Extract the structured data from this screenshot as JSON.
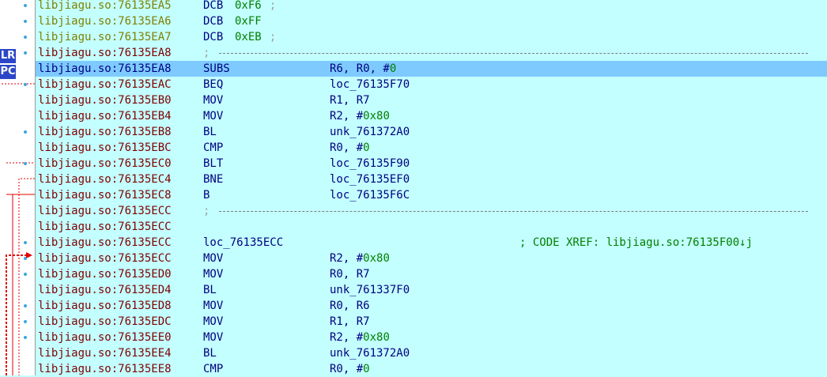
{
  "markers": {
    "lr": "LR",
    "pc": "PC"
  },
  "lines": [
    {
      "addr": "libjiagu.so:76135EA5",
      "type": "data",
      "mnemonic": "DCB",
      "operand": "0xF6",
      "trailing": ";"
    },
    {
      "addr": "libjiagu.so:76135EA6",
      "type": "data",
      "mnemonic": "DCB",
      "operand": "0xFF"
    },
    {
      "addr": "libjiagu.so:76135EA7",
      "type": "data",
      "mnemonic": "DCB",
      "operand": "0xEB",
      "trailing": ";"
    },
    {
      "addr": "libjiagu.so:76135EA8",
      "type": "separator",
      "trailing": ";"
    },
    {
      "addr": "libjiagu.so:76135EA8",
      "type": "code",
      "mnemonic": "SUBS",
      "op1": "R6, R0, #",
      "num": "0",
      "highlighted": true
    },
    {
      "addr": "libjiagu.so:76135EAC",
      "type": "code",
      "mnemonic": "BEQ",
      "op1": "loc_76135F70"
    },
    {
      "addr": "libjiagu.so:76135EB0",
      "type": "code",
      "mnemonic": "MOV",
      "op1": "R1, R7"
    },
    {
      "addr": "libjiagu.so:76135EB4",
      "type": "code",
      "mnemonic": "MOV",
      "op1": "R2, #",
      "num": "0x80"
    },
    {
      "addr": "libjiagu.so:76135EB8",
      "type": "code",
      "mnemonic": "BL",
      "op1": "unk_761372A0"
    },
    {
      "addr": "libjiagu.so:76135EBC",
      "type": "code",
      "mnemonic": "CMP",
      "op1": "R0, #",
      "num": "0"
    },
    {
      "addr": "libjiagu.so:76135EC0",
      "type": "code",
      "mnemonic": "BLT",
      "op1": "loc_76135F90"
    },
    {
      "addr": "libjiagu.so:76135EC4",
      "type": "code",
      "mnemonic": "BNE",
      "op1": "loc_76135EF0"
    },
    {
      "addr": "libjiagu.so:76135EC8",
      "type": "code",
      "mnemonic": "B",
      "op1": "loc_76135F6C"
    },
    {
      "addr": "libjiagu.so:76135ECC",
      "type": "separator",
      "trailing": ";"
    },
    {
      "addr": "libjiagu.so:76135ECC",
      "type": "blank"
    },
    {
      "addr": "libjiagu.so:76135ECC",
      "type": "label",
      "label": "loc_76135ECC",
      "comment": "; CODE XREF: libjiagu.so:76135F00↓j"
    },
    {
      "addr": "libjiagu.so:76135ECC",
      "type": "code",
      "mnemonic": "MOV",
      "op1": "R2, #",
      "num": "0x80"
    },
    {
      "addr": "libjiagu.so:76135ED0",
      "type": "code",
      "mnemonic": "MOV",
      "op1": "R0, R7"
    },
    {
      "addr": "libjiagu.so:76135ED4",
      "type": "code",
      "mnemonic": "BL",
      "op1": "unk_761337F0"
    },
    {
      "addr": "libjiagu.so:76135ED8",
      "type": "code",
      "mnemonic": "MOV",
      "op1": "R0, R6"
    },
    {
      "addr": "libjiagu.so:76135EDC",
      "type": "code",
      "mnemonic": "MOV",
      "op1": "R1, R7"
    },
    {
      "addr": "libjiagu.so:76135EE0",
      "type": "code",
      "mnemonic": "MOV",
      "op1": "R2, #",
      "num": "0x80"
    },
    {
      "addr": "libjiagu.so:76135EE4",
      "type": "code",
      "mnemonic": "BL",
      "op1": "unk_761372A0"
    },
    {
      "addr": "libjiagu.so:76135EE8",
      "type": "code",
      "mnemonic": "CMP",
      "op1": "R0, #",
      "num": "0"
    }
  ],
  "colors": {
    "background": "#c3ffff",
    "highlight": "#7ecaff",
    "address": "#800000",
    "data_address": "#808000",
    "instruction": "#000080",
    "immediate": "#008000",
    "comment": "#008000",
    "arrow": "#e00000"
  }
}
